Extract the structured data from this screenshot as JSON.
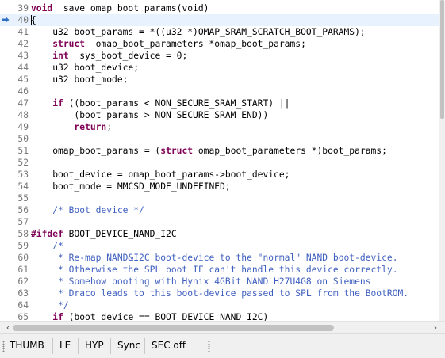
{
  "colors": {
    "keyword": "#7f0055",
    "comment": "#3f5fbf",
    "line_number": "#787878",
    "current_line": "#e8f2fe"
  },
  "editor": {
    "current_line": "40",
    "lines": [
      {
        "n": "39",
        "s": [
          [
            "kw",
            "void"
          ],
          [
            "",
            "  save_omap_boot_params(void)"
          ]
        ]
      },
      {
        "n": "40",
        "s": [
          [
            "",
            "{"
          ]
        ],
        "current": true
      },
      {
        "n": "41",
        "s": [
          [
            "",
            "    u32 boot_params = *((u32 *)OMAP_SRAM_SCRATCH_BOOT_PARAMS);"
          ]
        ]
      },
      {
        "n": "42",
        "s": [
          [
            "",
            "    "
          ],
          [
            "kw",
            "struct"
          ],
          [
            "",
            "  omap_boot_parameters *omap_boot_params;"
          ]
        ]
      },
      {
        "n": "43",
        "s": [
          [
            "",
            "    "
          ],
          [
            "kw",
            "int"
          ],
          [
            "",
            "  sys_boot_device = 0;"
          ]
        ]
      },
      {
        "n": "44",
        "s": [
          [
            "",
            "    u32 boot_device;"
          ]
        ]
      },
      {
        "n": "45",
        "s": [
          [
            "",
            "    u32 boot_mode;"
          ]
        ]
      },
      {
        "n": "46",
        "s": [
          [
            "",
            ""
          ]
        ]
      },
      {
        "n": "47",
        "s": [
          [
            "",
            "    "
          ],
          [
            "kw",
            "if"
          ],
          [
            "",
            " ((boot_params < NON_SECURE_SRAM_START) ||"
          ]
        ]
      },
      {
        "n": "48",
        "s": [
          [
            "",
            "        (boot_params > NON_SECURE_SRAM_END))"
          ]
        ]
      },
      {
        "n": "49",
        "s": [
          [
            "",
            "        "
          ],
          [
            "kw",
            "return"
          ],
          [
            "",
            ";"
          ]
        ]
      },
      {
        "n": "50",
        "s": [
          [
            "",
            ""
          ]
        ]
      },
      {
        "n": "51",
        "s": [
          [
            "",
            "    omap_boot_params = ("
          ],
          [
            "kw",
            "struct"
          ],
          [
            "",
            " omap_boot_parameters *)boot_params;"
          ]
        ]
      },
      {
        "n": "52",
        "s": [
          [
            "",
            ""
          ]
        ]
      },
      {
        "n": "53",
        "s": [
          [
            "",
            "    boot_device = omap_boot_params->boot_device;"
          ]
        ]
      },
      {
        "n": "54",
        "s": [
          [
            "",
            "    boot_mode = MMCSD_MODE_UNDEFINED;"
          ]
        ]
      },
      {
        "n": "55",
        "s": [
          [
            "",
            ""
          ]
        ]
      },
      {
        "n": "56",
        "s": [
          [
            "",
            "    "
          ],
          [
            "cm",
            "/* Boot device */"
          ]
        ]
      },
      {
        "n": "57",
        "s": [
          [
            "",
            ""
          ]
        ]
      },
      {
        "n": "58",
        "s": [
          [
            "kw",
            "#ifdef"
          ],
          [
            "",
            " BOOT_DEVICE_NAND_I2C"
          ]
        ]
      },
      {
        "n": "59",
        "s": [
          [
            "",
            "    "
          ],
          [
            "cm",
            "/*"
          ]
        ]
      },
      {
        "n": "60",
        "s": [
          [
            "",
            "    "
          ],
          [
            "cm",
            " * Re-map NAND&I2C boot-device to the \"normal\" NAND boot-device."
          ]
        ]
      },
      {
        "n": "61",
        "s": [
          [
            "",
            "    "
          ],
          [
            "cm",
            " * Otherwise the SPL boot IF can't handle this device correctly."
          ]
        ]
      },
      {
        "n": "62",
        "s": [
          [
            "",
            "    "
          ],
          [
            "cm",
            " * Somehow booting with Hynix 4GBit NAND H27U4G8 on Siemens"
          ]
        ]
      },
      {
        "n": "63",
        "s": [
          [
            "",
            "    "
          ],
          [
            "cm",
            " * Draco leads to this boot-device passed to SPL from the BootROM."
          ]
        ]
      },
      {
        "n": "64",
        "s": [
          [
            "",
            "    "
          ],
          [
            "cm",
            " */"
          ]
        ]
      },
      {
        "n": "65",
        "s": [
          [
            "",
            "    "
          ],
          [
            "kw",
            "if"
          ],
          [
            "",
            " (boot_device == BOOT_DEVICE_NAND_I2C)"
          ]
        ]
      }
    ]
  },
  "hscroll": {
    "left_arrow": "‹",
    "right_arrow": "›"
  },
  "statusbar": {
    "thumb": "THUMB",
    "le": "LE",
    "hyp": "HYP",
    "sync": "Sync",
    "sec": "SEC off"
  }
}
